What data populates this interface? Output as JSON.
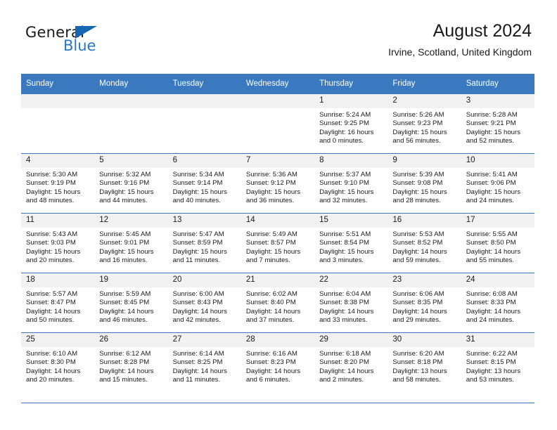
{
  "brand": {
    "name_part1": "General",
    "name_part2": "Blue",
    "triangle_color": "#1567b2",
    "blue_color": "#2878bd"
  },
  "header": {
    "title": "August 2024",
    "location": "Irvine, Scotland, United Kingdom"
  },
  "theme": {
    "header_row_bg": "#3a79bf",
    "daynum_band_bg": "#f1f1f1",
    "grid_line": "#3a79bf",
    "text": "#1a1a1a"
  },
  "columns": [
    "Sunday",
    "Monday",
    "Tuesday",
    "Wednesday",
    "Thursday",
    "Friday",
    "Saturday"
  ],
  "weeks": [
    [
      {
        "day": "",
        "empty": true
      },
      {
        "day": "",
        "empty": true
      },
      {
        "day": "",
        "empty": true
      },
      {
        "day": "",
        "empty": true
      },
      {
        "day": "1",
        "sunrise": "Sunrise: 5:24 AM",
        "sunset": "Sunset: 9:25 PM",
        "daylight1": "Daylight: 16 hours",
        "daylight2": "and 0 minutes."
      },
      {
        "day": "2",
        "sunrise": "Sunrise: 5:26 AM",
        "sunset": "Sunset: 9:23 PM",
        "daylight1": "Daylight: 15 hours",
        "daylight2": "and 56 minutes."
      },
      {
        "day": "3",
        "sunrise": "Sunrise: 5:28 AM",
        "sunset": "Sunset: 9:21 PM",
        "daylight1": "Daylight: 15 hours",
        "daylight2": "and 52 minutes."
      }
    ],
    [
      {
        "day": "4",
        "sunrise": "Sunrise: 5:30 AM",
        "sunset": "Sunset: 9:19 PM",
        "daylight1": "Daylight: 15 hours",
        "daylight2": "and 48 minutes."
      },
      {
        "day": "5",
        "sunrise": "Sunrise: 5:32 AM",
        "sunset": "Sunset: 9:16 PM",
        "daylight1": "Daylight: 15 hours",
        "daylight2": "and 44 minutes."
      },
      {
        "day": "6",
        "sunrise": "Sunrise: 5:34 AM",
        "sunset": "Sunset: 9:14 PM",
        "daylight1": "Daylight: 15 hours",
        "daylight2": "and 40 minutes."
      },
      {
        "day": "7",
        "sunrise": "Sunrise: 5:36 AM",
        "sunset": "Sunset: 9:12 PM",
        "daylight1": "Daylight: 15 hours",
        "daylight2": "and 36 minutes."
      },
      {
        "day": "8",
        "sunrise": "Sunrise: 5:37 AM",
        "sunset": "Sunset: 9:10 PM",
        "daylight1": "Daylight: 15 hours",
        "daylight2": "and 32 minutes."
      },
      {
        "day": "9",
        "sunrise": "Sunrise: 5:39 AM",
        "sunset": "Sunset: 9:08 PM",
        "daylight1": "Daylight: 15 hours",
        "daylight2": "and 28 minutes."
      },
      {
        "day": "10",
        "sunrise": "Sunrise: 5:41 AM",
        "sunset": "Sunset: 9:06 PM",
        "daylight1": "Daylight: 15 hours",
        "daylight2": "and 24 minutes."
      }
    ],
    [
      {
        "day": "11",
        "sunrise": "Sunrise: 5:43 AM",
        "sunset": "Sunset: 9:03 PM",
        "daylight1": "Daylight: 15 hours",
        "daylight2": "and 20 minutes."
      },
      {
        "day": "12",
        "sunrise": "Sunrise: 5:45 AM",
        "sunset": "Sunset: 9:01 PM",
        "daylight1": "Daylight: 15 hours",
        "daylight2": "and 16 minutes."
      },
      {
        "day": "13",
        "sunrise": "Sunrise: 5:47 AM",
        "sunset": "Sunset: 8:59 PM",
        "daylight1": "Daylight: 15 hours",
        "daylight2": "and 11 minutes."
      },
      {
        "day": "14",
        "sunrise": "Sunrise: 5:49 AM",
        "sunset": "Sunset: 8:57 PM",
        "daylight1": "Daylight: 15 hours",
        "daylight2": "and 7 minutes."
      },
      {
        "day": "15",
        "sunrise": "Sunrise: 5:51 AM",
        "sunset": "Sunset: 8:54 PM",
        "daylight1": "Daylight: 15 hours",
        "daylight2": "and 3 minutes."
      },
      {
        "day": "16",
        "sunrise": "Sunrise: 5:53 AM",
        "sunset": "Sunset: 8:52 PM",
        "daylight1": "Daylight: 14 hours",
        "daylight2": "and 59 minutes."
      },
      {
        "day": "17",
        "sunrise": "Sunrise: 5:55 AM",
        "sunset": "Sunset: 8:50 PM",
        "daylight1": "Daylight: 14 hours",
        "daylight2": "and 55 minutes."
      }
    ],
    [
      {
        "day": "18",
        "sunrise": "Sunrise: 5:57 AM",
        "sunset": "Sunset: 8:47 PM",
        "daylight1": "Daylight: 14 hours",
        "daylight2": "and 50 minutes."
      },
      {
        "day": "19",
        "sunrise": "Sunrise: 5:59 AM",
        "sunset": "Sunset: 8:45 PM",
        "daylight1": "Daylight: 14 hours",
        "daylight2": "and 46 minutes."
      },
      {
        "day": "20",
        "sunrise": "Sunrise: 6:00 AM",
        "sunset": "Sunset: 8:43 PM",
        "daylight1": "Daylight: 14 hours",
        "daylight2": "and 42 minutes."
      },
      {
        "day": "21",
        "sunrise": "Sunrise: 6:02 AM",
        "sunset": "Sunset: 8:40 PM",
        "daylight1": "Daylight: 14 hours",
        "daylight2": "and 37 minutes."
      },
      {
        "day": "22",
        "sunrise": "Sunrise: 6:04 AM",
        "sunset": "Sunset: 8:38 PM",
        "daylight1": "Daylight: 14 hours",
        "daylight2": "and 33 minutes."
      },
      {
        "day": "23",
        "sunrise": "Sunrise: 6:06 AM",
        "sunset": "Sunset: 8:35 PM",
        "daylight1": "Daylight: 14 hours",
        "daylight2": "and 29 minutes."
      },
      {
        "day": "24",
        "sunrise": "Sunrise: 6:08 AM",
        "sunset": "Sunset: 8:33 PM",
        "daylight1": "Daylight: 14 hours",
        "daylight2": "and 24 minutes."
      }
    ],
    [
      {
        "day": "25",
        "sunrise": "Sunrise: 6:10 AM",
        "sunset": "Sunset: 8:30 PM",
        "daylight1": "Daylight: 14 hours",
        "daylight2": "and 20 minutes."
      },
      {
        "day": "26",
        "sunrise": "Sunrise: 6:12 AM",
        "sunset": "Sunset: 8:28 PM",
        "daylight1": "Daylight: 14 hours",
        "daylight2": "and 15 minutes."
      },
      {
        "day": "27",
        "sunrise": "Sunrise: 6:14 AM",
        "sunset": "Sunset: 8:25 PM",
        "daylight1": "Daylight: 14 hours",
        "daylight2": "and 11 minutes."
      },
      {
        "day": "28",
        "sunrise": "Sunrise: 6:16 AM",
        "sunset": "Sunset: 8:23 PM",
        "daylight1": "Daylight: 14 hours",
        "daylight2": "and 6 minutes."
      },
      {
        "day": "29",
        "sunrise": "Sunrise: 6:18 AM",
        "sunset": "Sunset: 8:20 PM",
        "daylight1": "Daylight: 14 hours",
        "daylight2": "and 2 minutes."
      },
      {
        "day": "30",
        "sunrise": "Sunrise: 6:20 AM",
        "sunset": "Sunset: 8:18 PM",
        "daylight1": "Daylight: 13 hours",
        "daylight2": "and 58 minutes."
      },
      {
        "day": "31",
        "sunrise": "Sunrise: 6:22 AM",
        "sunset": "Sunset: 8:15 PM",
        "daylight1": "Daylight: 13 hours",
        "daylight2": "and 53 minutes."
      }
    ]
  ]
}
